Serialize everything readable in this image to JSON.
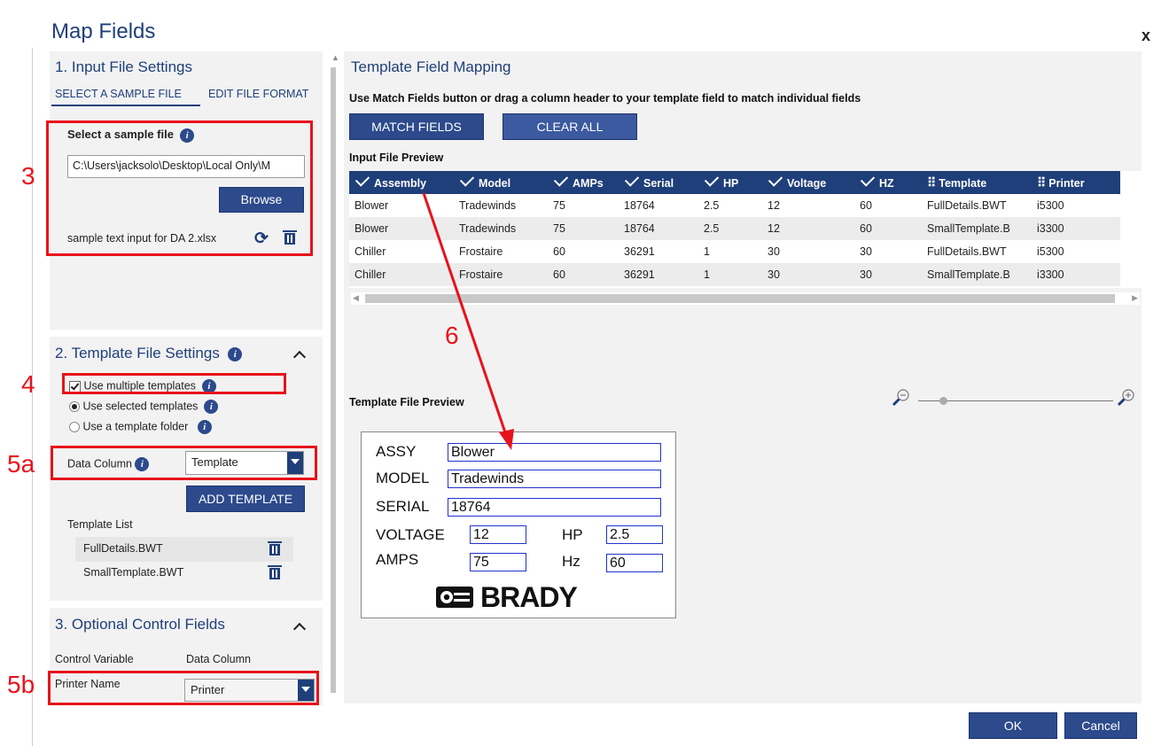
{
  "dialog": {
    "title": "Map Fields",
    "close_label": "x"
  },
  "input_settings": {
    "heading": "1. Input File Settings",
    "tab_select": "SELECT A SAMPLE FILE",
    "tab_edit": "EDIT FILE FORMAT",
    "select_label": "Select a sample file",
    "path_value": "C:\\Users\\jacksolo\\Desktop\\Local Only\\M",
    "browse_label": "Browse",
    "file_name": "sample text input for DA 2.xlsx",
    "refresh_glyph": "⟳"
  },
  "template_settings": {
    "heading": "2. Template File Settings",
    "use_multiple": "Use multiple templates",
    "use_selected": "Use selected templates",
    "use_folder": "Use a template folder",
    "data_column_label": "Data Column",
    "data_column_value": "Template",
    "add_template_label": "ADD TEMPLATE",
    "template_list_label": "Template List",
    "templates": [
      "FullDetails.BWT",
      "SmallTemplate.BWT"
    ]
  },
  "control_fields": {
    "heading": "3. Optional Control Fields",
    "col_control": "Control Variable",
    "col_data": "Data Column",
    "printer_name_label": "Printer Name",
    "printer_value": "Printer"
  },
  "mapping": {
    "heading": "Template Field Mapping",
    "instructions": "Use Match Fields button or drag a column header to your template field to match individual fields",
    "match_label": "MATCH FIELDS",
    "clear_label": "CLEAR ALL",
    "input_preview_label": "Input File Preview",
    "columns": [
      {
        "label": "Assembly",
        "mark": "check"
      },
      {
        "label": "Model",
        "mark": "check"
      },
      {
        "label": "AMPs",
        "mark": "check"
      },
      {
        "label": "Serial",
        "mark": "check"
      },
      {
        "label": "HP",
        "mark": "check"
      },
      {
        "label": "Voltage",
        "mark": "check"
      },
      {
        "label": "HZ",
        "mark": "check"
      },
      {
        "label": "Template",
        "mark": "drag"
      },
      {
        "label": "Printer",
        "mark": "drag"
      }
    ],
    "rows": [
      [
        "Blower",
        "Tradewinds",
        "75",
        "18764",
        "2.5",
        "12",
        "60",
        "FullDetails.BWT",
        "i5300"
      ],
      [
        "Blower",
        "Tradewinds",
        "75",
        "18764",
        "2.5",
        "12",
        "60",
        "SmallTemplate.B",
        "i3300"
      ],
      [
        "Chiller",
        "Frostaire",
        "60",
        "36291",
        "1",
        "30",
        "30",
        "FullDetails.BWT",
        "i5300"
      ],
      [
        "Chiller",
        "Frostaire",
        "60",
        "36291",
        "1",
        "30",
        "30",
        "SmallTemplate.B",
        "i3300"
      ]
    ],
    "template_preview_label": "Template File Preview",
    "zoom_level": 0.02
  },
  "template_preview": {
    "assy_label": "ASSY",
    "assy_value": "Blower",
    "model_label": "MODEL",
    "model_value": "Tradewinds",
    "serial_label": "SERIAL",
    "serial_value": "18764",
    "voltage_label": "VOLTAGE",
    "voltage_value": "12",
    "hp_label": "HP",
    "hp_value": "2.5",
    "amps_label": "AMPS",
    "amps_value": "75",
    "hz_label": "Hz",
    "hz_value": "60",
    "logo_text": "BRADY"
  },
  "annotations": {
    "n3": "3",
    "n4": "4",
    "n5a": "5a",
    "n5b": "5b",
    "n6": "6"
  },
  "footer": {
    "ok_label": "OK",
    "cancel_label": "Cancel"
  },
  "colors": {
    "accent": "#1f3f7a",
    "button": "#2c4a8c",
    "annotation": "#e8121b"
  }
}
